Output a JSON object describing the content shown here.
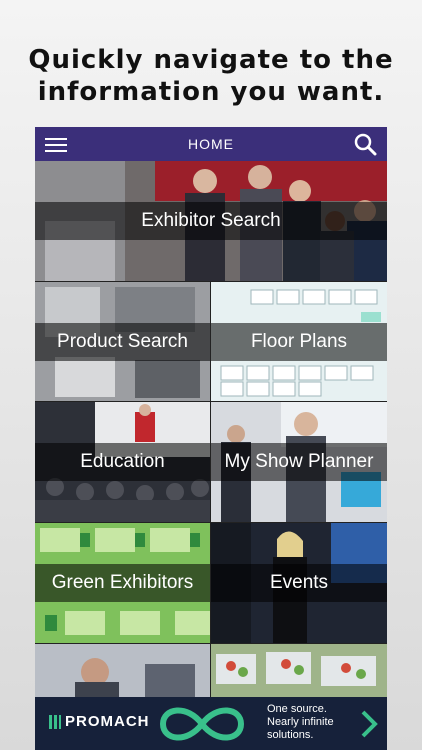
{
  "headline": {
    "line1": "Quickly navigate to the",
    "line2": "information you want."
  },
  "navbar": {
    "title": "HOME",
    "color": "#3b2f7a"
  },
  "tiles": [
    {
      "label": "Exhibitor Search"
    },
    {
      "label": "Product Search"
    },
    {
      "label": "Floor Plans"
    },
    {
      "label": "Education"
    },
    {
      "label": "My Show Planner"
    },
    {
      "label": "Green Exhibitors"
    },
    {
      "label": "Events"
    }
  ],
  "ad": {
    "brand": "PROMACH",
    "tagline_line1": "One source.",
    "tagline_line2": "Nearly infinite",
    "tagline_line3": "solutions.",
    "accent": "#39c08b"
  }
}
